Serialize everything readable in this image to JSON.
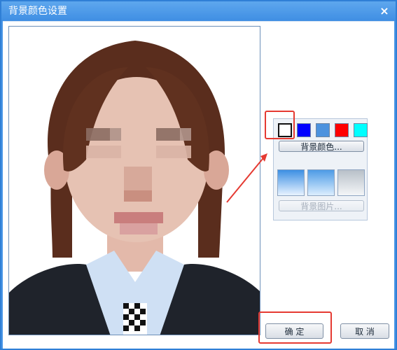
{
  "window": {
    "title": "背景颜色设置",
    "close_glyph": "×"
  },
  "colors": {
    "titlebar": "#4a97e6",
    "highlight": "#e53a32",
    "arrow": "#e53a32"
  },
  "swatch_panel": {
    "swatches": [
      {
        "name": "white",
        "color": "#ffffff",
        "selected": true
      },
      {
        "name": "blue",
        "color": "#0000ff"
      },
      {
        "name": "light-blue",
        "color": "#4c92de"
      },
      {
        "name": "red",
        "color": "#ff0000"
      },
      {
        "name": "cyan",
        "color": "#00ffff"
      }
    ],
    "bg_color_button": "背景颜色...",
    "gradients": [
      {
        "name": "blue-gradient-1"
      },
      {
        "name": "blue-gradient-2"
      },
      {
        "name": "gray-gradient"
      }
    ],
    "bg_image_button": "背景图片..."
  },
  "footer": {
    "ok_label": "确  定",
    "cancel_label": "取  消"
  }
}
